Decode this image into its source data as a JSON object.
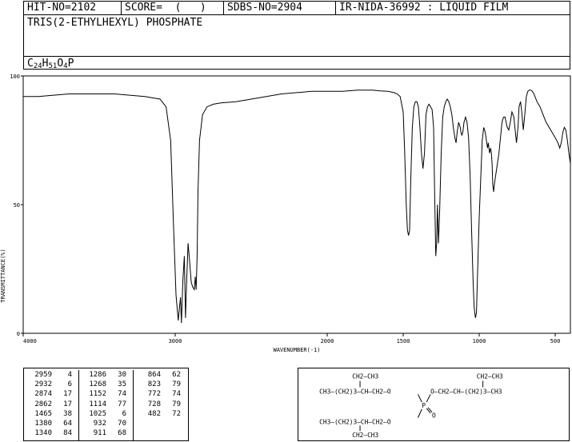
{
  "header": {
    "hit_no": "HIT-NO=2102",
    "score": "SCORE=  (   )",
    "sdbs_no": "SDBS-NO=2904",
    "ir_source": "IR-NIDA-36992 : LIQUID FILM",
    "compound_name": "TRIS(2-ETHYLHEXYL) PHOSPHATE",
    "formula": {
      "C": "C",
      "c_count": "24",
      "H": "H",
      "h_count": "51",
      "O": "O",
      "o_count": "4",
      "P": "P"
    }
  },
  "chart_data": {
    "type": "line",
    "xlabel": "WAVENUMBER(-1)",
    "ylabel": "TRANSMITTANCE(%)",
    "xlim": [
      4000,
      400
    ],
    "ylim": [
      0,
      100
    ],
    "xticks": [
      "4000",
      "3000",
      "2000",
      "1500",
      "1000",
      "500"
    ],
    "yticks": [
      "100",
      "50",
      "0"
    ],
    "x": [
      4000,
      3900,
      3800,
      3700,
      3600,
      3500,
      3400,
      3300,
      3200,
      3100,
      3060,
      3030,
      3010,
      2995,
      2980,
      2965,
      2959,
      2950,
      2940,
      2932,
      2925,
      2915,
      2905,
      2895,
      2885,
      2874,
      2868,
      2862,
      2856,
      2850,
      2840,
      2820,
      2790,
      2750,
      2700,
      2600,
      2500,
      2400,
      2300,
      2200,
      2100,
      2000,
      1900,
      1800,
      1700,
      1650,
      1600,
      1560,
      1540,
      1520,
      1500,
      1490,
      1480,
      1472,
      1465,
      1458,
      1450,
      1440,
      1430,
      1420,
      1410,
      1400,
      1390,
      1380,
      1370,
      1360,
      1350,
      1340,
      1330,
      1320,
      1310,
      1300,
      1295,
      1286,
      1280,
      1275,
      1268,
      1260,
      1250,
      1240,
      1230,
      1220,
      1210,
      1200,
      1190,
      1180,
      1170,
      1160,
      1152,
      1145,
      1135,
      1125,
      1120,
      1114,
      1108,
      1100,
      1090,
      1080,
      1070,
      1060,
      1050,
      1040,
      1033,
      1025,
      1018,
      1010,
      1000,
      990,
      980,
      970,
      960,
      950,
      945,
      940,
      932,
      925,
      920,
      915,
      911,
      905,
      900,
      890,
      880,
      870,
      860,
      850,
      840,
      830,
      823,
      815,
      805,
      795,
      785,
      778,
      772,
      765,
      755,
      745,
      738,
      728,
      720,
      710,
      700,
      690,
      680,
      670,
      660,
      650,
      640,
      620,
      600,
      580,
      560,
      540,
      520,
      500,
      482,
      470,
      460,
      450,
      440,
      430,
      420,
      410,
      400
    ],
    "y": [
      92,
      92,
      92.5,
      93,
      93,
      93,
      93,
      92.5,
      92,
      91,
      88,
      75,
      40,
      15,
      5,
      14,
      4,
      20,
      30,
      6,
      20,
      35,
      28,
      20,
      18,
      17,
      22,
      17,
      30,
      55,
      75,
      85,
      88,
      89,
      89.5,
      90,
      91,
      92,
      93,
      93.5,
      94,
      94,
      94,
      94.5,
      94.5,
      94.2,
      94,
      93.5,
      93,
      92,
      86,
      70,
      50,
      40,
      38,
      40,
      60,
      80,
      88,
      90,
      90,
      88,
      80,
      70,
      64,
      70,
      85,
      88,
      89,
      88,
      87,
      80,
      60,
      30,
      35,
      50,
      35,
      48,
      70,
      84,
      88,
      90,
      91,
      90,
      88,
      85,
      80,
      76,
      74,
      78,
      82,
      80,
      78,
      77,
      78,
      82,
      84,
      82,
      76,
      62,
      40,
      20,
      10,
      6,
      8,
      25,
      45,
      60,
      75,
      80,
      78,
      74,
      72,
      74,
      70,
      72,
      70,
      66,
      58,
      55,
      58,
      62,
      66,
      70,
      76,
      82,
      84,
      84,
      82,
      80,
      79,
      82,
      86,
      85,
      84,
      80,
      74,
      80,
      88,
      90,
      86,
      79,
      85,
      92,
      94,
      94.5,
      94.5,
      94,
      93,
      90,
      88,
      85,
      82,
      80,
      78,
      76,
      74,
      72,
      74,
      78,
      80,
      79,
      75,
      70,
      66,
      62,
      60
    ],
    "peaks": [
      {
        "wavenumber": "2959",
        "transmittance": "4"
      },
      {
        "wavenumber": "2932",
        "transmittance": "6"
      },
      {
        "wavenumber": "2874",
        "transmittance": "17"
      },
      {
        "wavenumber": "2862",
        "transmittance": "17"
      },
      {
        "wavenumber": "1465",
        "transmittance": "38"
      },
      {
        "wavenumber": "1380",
        "transmittance": "64"
      },
      {
        "wavenumber": "1340",
        "transmittance": "84"
      },
      {
        "wavenumber": "1286",
        "transmittance": "30"
      },
      {
        "wavenumber": "1268",
        "transmittance": "35"
      },
      {
        "wavenumber": "1152",
        "transmittance": "74"
      },
      {
        "wavenumber": "1114",
        "transmittance": "77"
      },
      {
        "wavenumber": "1025",
        "transmittance": "6"
      },
      {
        "wavenumber": "932",
        "transmittance": "70"
      },
      {
        "wavenumber": "911",
        "transmittance": "68"
      },
      {
        "wavenumber": "864",
        "transmittance": "62"
      },
      {
        "wavenumber": "823",
        "transmittance": "79"
      },
      {
        "wavenumber": "772",
        "transmittance": "74"
      },
      {
        "wavenumber": "728",
        "transmittance": "79"
      },
      {
        "wavenumber": "482",
        "transmittance": "72"
      }
    ]
  },
  "structure": {
    "top_branch": "CH2—CH3",
    "row1_left": "CH3—(CH2)3—CH—CH2—O",
    "phosphorus": "P",
    "row1_right": "O—CH2—CH—(CH2)3—CH3",
    "right_branch": "CH2—CH3",
    "double_o": "O",
    "row2_left": "CH3—(CH2)3—CH—CH2—O",
    "bottom_branch": "CH2—CH3",
    "ester_o": "O"
  }
}
